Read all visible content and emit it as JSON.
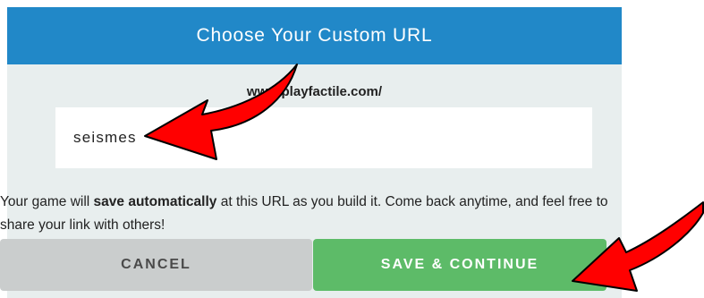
{
  "dialog": {
    "title": "Choose Your Custom URL",
    "url_prefix": "www.playfactile.com/",
    "url_value": "seismes",
    "info_pre": "Your game will ",
    "info_bold": "save automatically",
    "info_post": " at this URL as you build it. Come back anytime, and feel free to share your link with others!",
    "cancel_label": "CANCEL",
    "save_label": "SAVE & CONTINUE"
  },
  "colors": {
    "header": "#2188c8",
    "panel": "#e8eeee",
    "save": "#5dbb68",
    "cancel": "#cacdcd",
    "annotation_arrow": "#ff0000"
  }
}
